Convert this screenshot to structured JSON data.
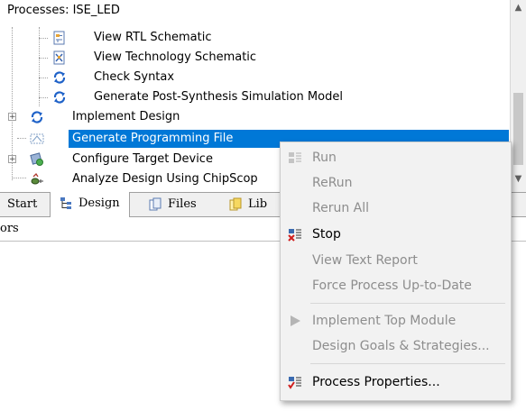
{
  "process_panel": {
    "header": "Processes: ISE_LED",
    "items": [
      {
        "label": "View RTL Schematic",
        "icon": "schematic-doc-icon"
      },
      {
        "label": "View Technology Schematic",
        "icon": "tech-schematic-doc-icon"
      },
      {
        "label": "Check Syntax",
        "icon": "refresh-arrows-icon"
      },
      {
        "label": "Generate Post-Synthesis Simulation Model",
        "icon": "refresh-arrows-icon"
      },
      {
        "label": "Implement Design",
        "icon": "refresh-arrows-icon"
      },
      {
        "label": "Generate Programming File",
        "icon": "programming-file-icon"
      },
      {
        "label": "Configure Target Device",
        "icon": "target-device-icon"
      },
      {
        "label": "Analyze Design Using ChipScop",
        "icon": "chipscope-icon"
      }
    ]
  },
  "tabs": [
    {
      "label": "Start"
    },
    {
      "label": "Design"
    },
    {
      "label": "Files"
    },
    {
      "label": "Lib"
    }
  ],
  "status_strip": {
    "text": "ors"
  },
  "context_menu": {
    "items": [
      {
        "label": "Run",
        "enabled": false,
        "icon": "run-icon"
      },
      {
        "label": "ReRun",
        "enabled": false
      },
      {
        "label": "Rerun All",
        "enabled": false
      },
      {
        "label": "Stop",
        "enabled": true,
        "icon": "stop-icon"
      },
      {
        "label": "View Text Report",
        "enabled": false
      },
      {
        "label": "Force Process Up-to-Date",
        "enabled": false
      },
      {
        "label": "Implement Top Module",
        "enabled": false,
        "icon": "play-triangle-icon"
      },
      {
        "label": "Design Goals & Strategies...",
        "enabled": false
      },
      {
        "label": "Process Properties...",
        "enabled": true,
        "icon": "process-properties-icon"
      }
    ]
  },
  "colors": {
    "selection": "#0078d7",
    "menu_bg": "#f2f2f2",
    "disabled_text": "#8d8d8d"
  }
}
